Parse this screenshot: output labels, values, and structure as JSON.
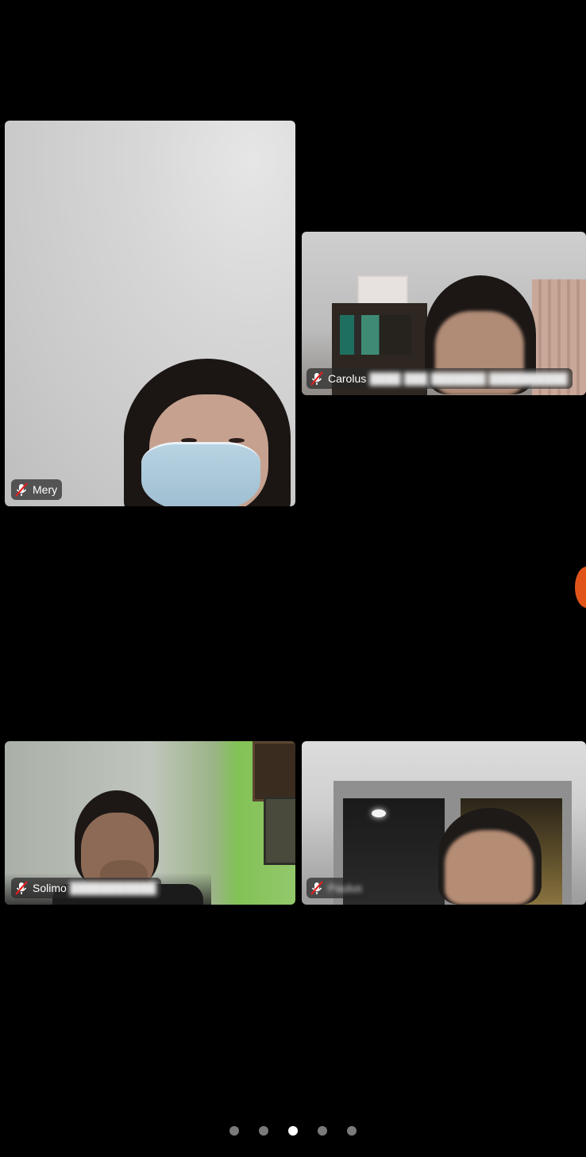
{
  "participants": [
    {
      "name": "Mery",
      "muted": true
    },
    {
      "name": "Carolus",
      "muted": true
    },
    {
      "name": "Solimo",
      "muted": true
    },
    {
      "name": "Paulus",
      "muted": true
    }
  ],
  "pager": {
    "page_count": 5,
    "current_page": 3
  },
  "colors": {
    "background": "#000000",
    "badge_bg": "#282828",
    "mic_muted": "#e02020",
    "active_dot": "#ffffff",
    "inactive_dot": "#7a7a7a",
    "edge_indicator": "#e0541a"
  },
  "icons": {
    "muted_mic": "mic-off-icon"
  }
}
